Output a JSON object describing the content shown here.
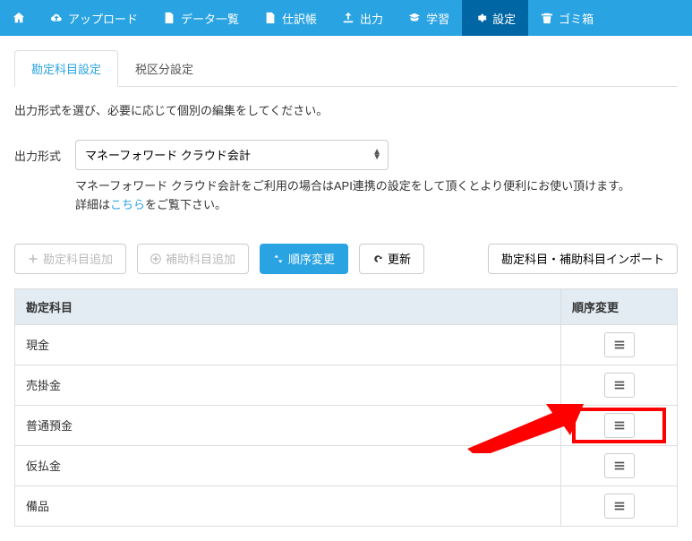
{
  "nav": {
    "items": [
      {
        "label": "",
        "icon": "home"
      },
      {
        "label": "アップロード",
        "icon": "cloud-upload"
      },
      {
        "label": "データ一覧",
        "icon": "file"
      },
      {
        "label": "仕訳帳",
        "icon": "book"
      },
      {
        "label": "出力",
        "icon": "export"
      },
      {
        "label": "学習",
        "icon": "graduation"
      },
      {
        "label": "設定",
        "icon": "gear"
      },
      {
        "label": "ゴミ箱",
        "icon": "trash"
      }
    ]
  },
  "tabs": {
    "account": "勘定科目設定",
    "tax": "税区分設定"
  },
  "instruction": "出力形式を選び、必要に応じて個別の編集をしてください。",
  "form": {
    "output_format_label": "出力形式",
    "output_format_value": "マネーフォワード クラウド会計",
    "help_line1": "マネーフォワード クラウド会計をご利用の場合はAPI連携の設定をして頂くとより便利にお使い頂けます。",
    "help_line2_prefix": "詳細は",
    "help_link": "こちら",
    "help_line2_suffix": "をご覧下さい。"
  },
  "buttons": {
    "add_account": "勘定科目追加",
    "add_sub": "補助科目追加",
    "reorder": "順序変更",
    "refresh": "更新",
    "import": "勘定科目・補助科目インポート"
  },
  "table": {
    "header_account": "勘定科目",
    "header_order": "順序変更",
    "rows": [
      {
        "name": "現金"
      },
      {
        "name": "売掛金"
      },
      {
        "name": "普通預金"
      },
      {
        "name": "仮払金"
      },
      {
        "name": "備品"
      }
    ]
  }
}
